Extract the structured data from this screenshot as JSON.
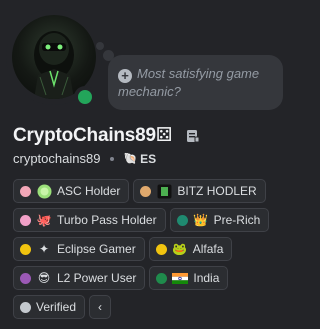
{
  "profile": {
    "display_name": "CryptoChains89",
    "display_name_glyph": "⚄",
    "username": "cryptochains89",
    "tag": {
      "icon": "clan-tag-icon",
      "glyph": "🐚",
      "label": "ES"
    },
    "status_text": "Most satisfying game mechanic?",
    "status_color": "#23a55a"
  },
  "roles": [
    {
      "label": "ASC Holder",
      "dot_color": "#f3a7b8",
      "icon": "green-coin-icon",
      "glyph": "",
      "icon_color": "#9be07a"
    },
    {
      "label": "BITZ HODLER",
      "dot_color": "#e0a96d",
      "icon": "bitz-token-icon",
      "glyph": "",
      "icon_color": "#111111"
    },
    {
      "label": "Turbo Pass Holder",
      "dot_color": "#f1a0c7",
      "icon": "octopus-icon",
      "glyph": "🐙",
      "icon_color": ""
    },
    {
      "label": "Pre-Rich",
      "dot_color": "#1f8a70",
      "icon": "crown-icon",
      "glyph": "👑",
      "icon_color": ""
    },
    {
      "label": "Eclipse Gamer",
      "dot_color": "#f1c40f",
      "icon": "eclipse-icon",
      "glyph": "✦",
      "icon_color": ""
    },
    {
      "label": "Alfafa",
      "dot_color": "#f1c40f",
      "icon": "mascot-icon",
      "glyph": "🐸",
      "icon_color": ""
    },
    {
      "label": "L2 Power User",
      "dot_color": "#9b59b6",
      "icon": "sunglasses-icon",
      "glyph": "😎",
      "icon_color": ""
    },
    {
      "label": "India",
      "dot_color": "#1f8b4c",
      "icon": "india-flag-icon",
      "glyph": "🇮🇳",
      "icon_color": ""
    },
    {
      "label": "Verified",
      "dot_color": "#c4c9ce",
      "icon": "",
      "glyph": "",
      "icon_color": ""
    }
  ],
  "collapse_label": "‹"
}
